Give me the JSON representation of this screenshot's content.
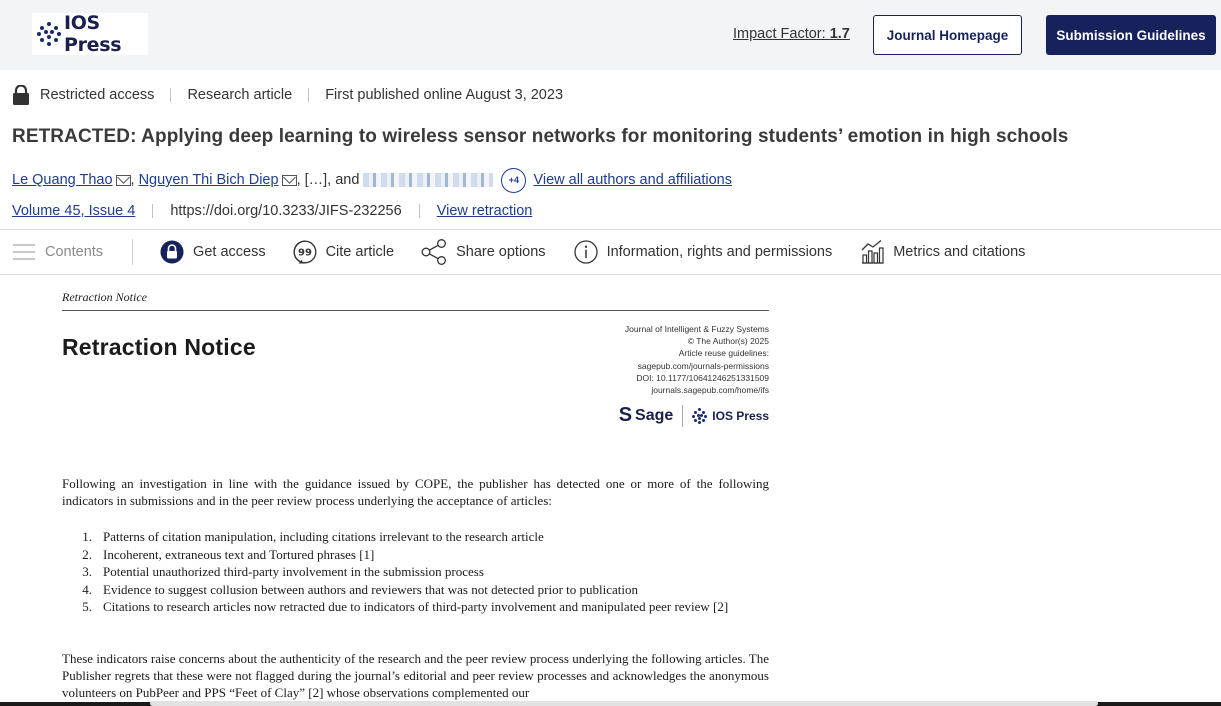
{
  "header": {
    "logo_text": "IOS Press",
    "impact_label": "Impact Factor:",
    "impact_value": "1.7",
    "homepage_button": "Journal Homepage",
    "guidelines_button": "Submission Guidelines"
  },
  "meta": {
    "access": "Restricted access",
    "type": "Research article",
    "published": "First published online August 3, 2023"
  },
  "article": {
    "title": "RETRACTED: Applying deep learning to wireless sensor networks for monitoring students’ emotion in high schools",
    "authors": [
      "Le Quang Thao",
      "Nguyen Thi Bich Diep"
    ],
    "author_ellipsis": ", […], and",
    "more_authors_badge": "+4",
    "view_all_authors": "View all authors and affiliations",
    "volume": "Volume 45, Issue 4",
    "doi": "https://doi.org/10.3233/JIFS-232256",
    "view_retraction": "View retraction"
  },
  "toolbar": {
    "contents": "Contents",
    "get_access": "Get access",
    "cite": "Cite article",
    "share": "Share options",
    "info": "Information, rights and permissions",
    "metrics": "Metrics and citations"
  },
  "pdf": {
    "header": "Retraction Notice",
    "heading": "Retraction Notice",
    "meta_lines": [
      "Journal of Intelligent & Fuzzy Systems",
      "© The Author(s) 2025",
      "Article reuse guidelines:",
      "sagepub.com/journals-permissions",
      "DOI: 10.1177/10641246251331509",
      "journals.sagepub.com/home/ifs"
    ],
    "sage_logo": "Sage",
    "ios_logo": "IOS Press",
    "intro": "Following an investigation in line with the guidance issued by COPE, the publisher has detected one or more of the following indicators in submissions and in the peer review process underlying the acceptance of articles:",
    "list": [
      {
        "num": "1.",
        "text": "Patterns of citation manipulation, including citations irrelevant to the research article"
      },
      {
        "num": "2.",
        "text": "Incoherent, extraneous text and Tortured phrases [1]"
      },
      {
        "num": "3.",
        "text": "Potential unauthorized third-party involvement in the submission process"
      },
      {
        "num": "4.",
        "text": "Evidence to suggest collusion between authors and reviewers that was not detected prior to publication"
      },
      {
        "num": "5.",
        "text": "Citations to research articles now retracted due to indicators of third-party involvement and manipulated peer review [2]"
      }
    ],
    "closing": "These indicators raise concerns about the authenticity of the research and the peer review process underlying the following articles. The Publisher regrets that these were not flagged during the journal’s editorial and peer review processes and acknowledges the anonymous volunteers on PubPeer and PPS “Feet of Clay” [2] whose observations complemented our"
  }
}
